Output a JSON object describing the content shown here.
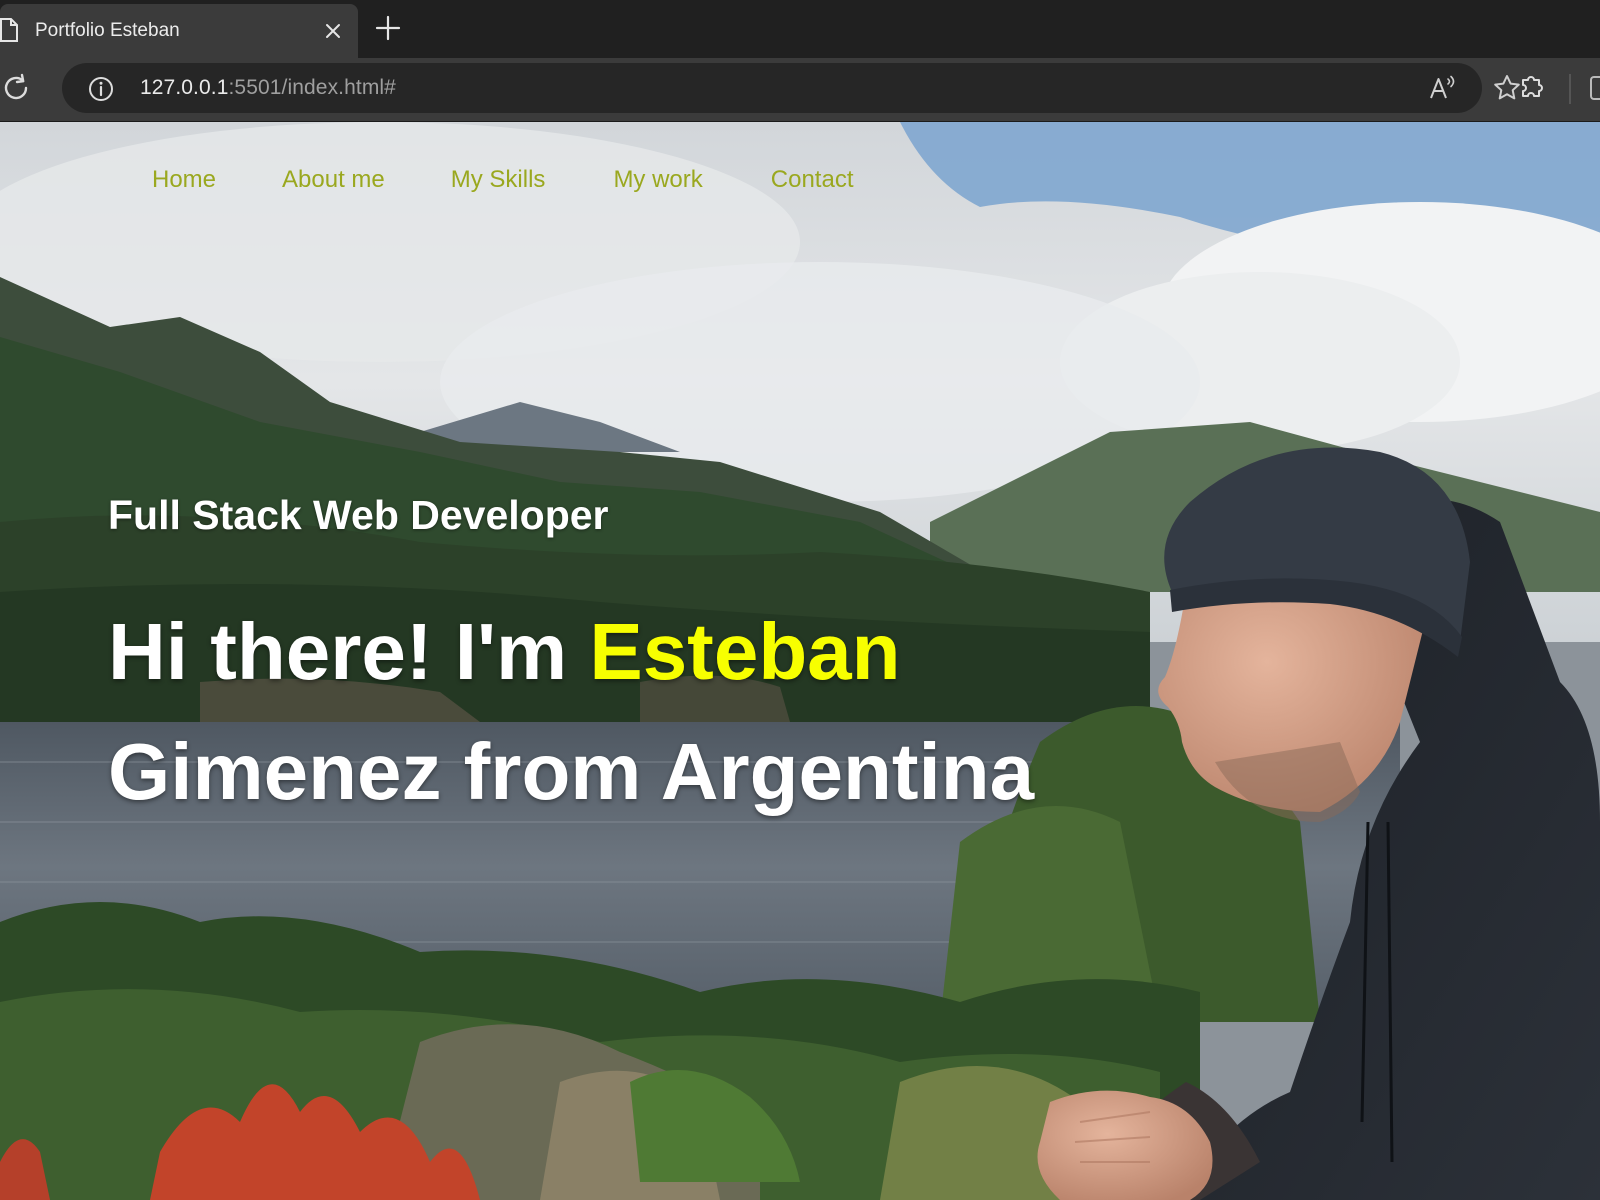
{
  "browser": {
    "tab": {
      "title": "Portfolio Esteban"
    },
    "url": {
      "host": "127.0.0.1",
      "rest": ":5501/index.html#"
    }
  },
  "icons": {
    "tab_page": "document-icon",
    "tab_close": "close-icon",
    "new_tab": "plus-icon",
    "reload": "reload-icon",
    "site_info": "info-icon",
    "read_aloud": "read-aloud-icon",
    "favorite": "star-icon",
    "extensions": "puzzle-icon"
  },
  "nav": {
    "items": [
      {
        "label": "Home"
      },
      {
        "label": "About me"
      },
      {
        "label": "My Skills"
      },
      {
        "label": "My work"
      },
      {
        "label": "Contact"
      }
    ]
  },
  "hero": {
    "subtitle": "Full Stack Web Developer",
    "greeting": "Hi there! I'm ",
    "first_name": "Esteban",
    "rest": "Gimenez from Argentina"
  },
  "colors": {
    "nav_link": "#9aa81f",
    "name_highlight": "#f7ff00",
    "heading_text": "#ffffff"
  }
}
